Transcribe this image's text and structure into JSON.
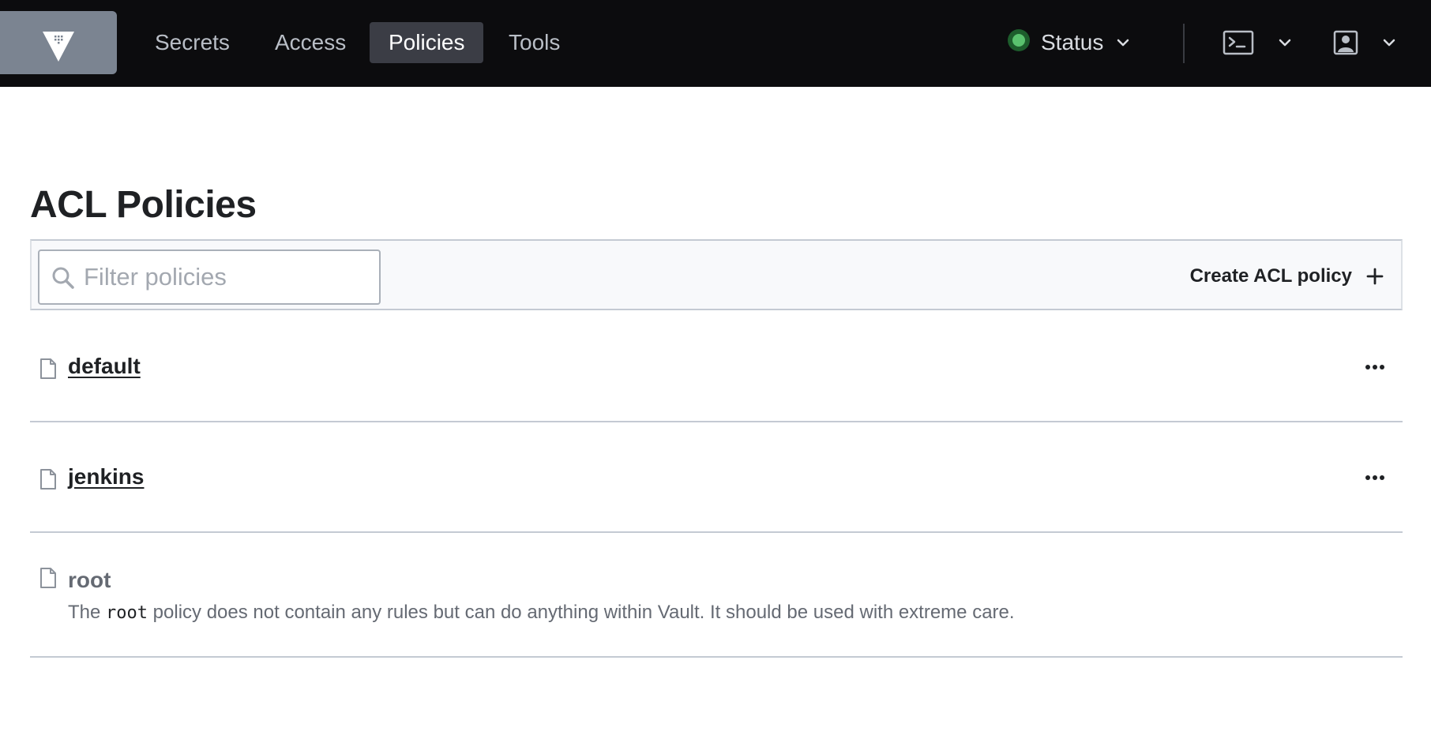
{
  "nav": {
    "links": [
      {
        "label": "Secrets"
      },
      {
        "label": "Access"
      },
      {
        "label": "Policies",
        "active": true
      },
      {
        "label": "Tools"
      }
    ],
    "status": {
      "label": "Status",
      "indicator": "healthy"
    },
    "console_icon": "terminal-icon",
    "user_icon": "user-square-icon",
    "logo_icon": "vault-logo-icon"
  },
  "page": {
    "title": "ACL Policies"
  },
  "toolbar": {
    "search_placeholder": "Filter policies",
    "search_value": "",
    "create_label": "Create ACL policy",
    "create_icon": "plus-icon"
  },
  "policies": [
    {
      "name": "default",
      "link": true,
      "menu": true
    },
    {
      "name": "jenkins",
      "link": true,
      "menu": true
    },
    {
      "name": "root",
      "link": false,
      "menu": false,
      "description_before": "The ",
      "description_code": "root",
      "description_after": " policy does not contain any rules but can do anything within Vault. It should be used with extreme care."
    }
  ],
  "colors": {
    "nav_bg": "#0c0c0e",
    "logo_bg": "#7b8491",
    "active_nav_bg": "#3b3d45",
    "status_ok": "#5ac26e",
    "border": "#c4cad3"
  }
}
